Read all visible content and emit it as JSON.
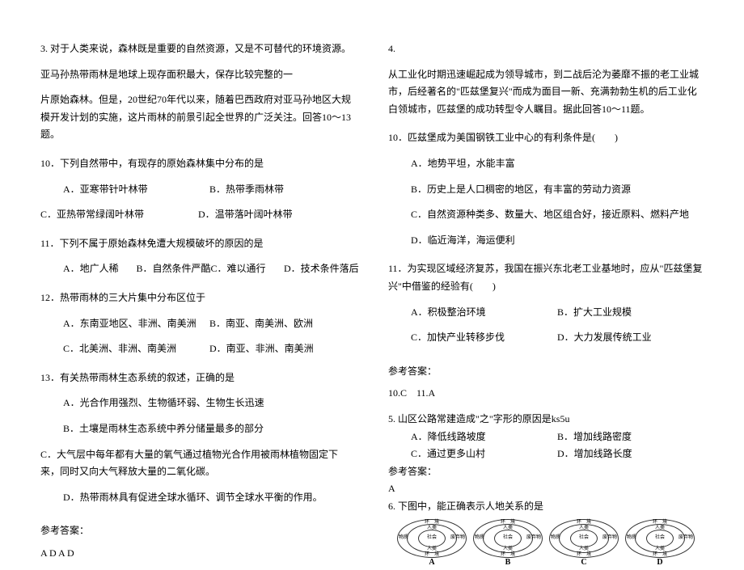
{
  "left": {
    "heading": "3. 对于人类来说，森林既是重要的自然资源，又是不可替代的环境资源。",
    "intro2": "亚马孙热带雨林是地球上现存面积最大，保存比较完整的一",
    "intro3": "片原始森林。但是，20世纪70年代以来，随着巴西政府对亚马孙地区大规模开发计划的实施，这片雨林的前景引起全世界的广泛关注。回答10～13题。",
    "q10": "10．下列自然带中，有现存的原始森林集中分布的是",
    "q10a": "A．亚寒带针叶林带",
    "q10b": "B．热带季雨林带",
    "q10c": "C．亚热带常绿阔叶林带",
    "q10d": "D．温带落叶阔叶林带",
    "q11": "11．下列不属于原始森林免遭大规模破坏的原因的是",
    "q11a": "A．地广人稀",
    "q11b": "B．自然条件严酷",
    "q11c": "C．难以通行",
    "q11d": "D．技术条件落后",
    "q12": "12．热带雨林的三大片集中分布区位于",
    "q12a": "A．东南亚地区、非洲、南美洲",
    "q12b": "B．南亚、南美洲、欧洲",
    "q12c": "C．北美洲、非洲、南美洲",
    "q12d": "D．南亚、非洲、南美洲",
    "q13": "13．有关热带雨林生态系统的叙述，正确的是",
    "q13a": "A．光合作用强烈、生物循环弱、生物生长迅速",
    "q13b": "B．土壤是雨林生态系统中养分储量最多的部分",
    "q13c": "C．大气层中每年都有大量的氧气通过植物光合作用被雨林植物固定下来，同时又向大气释放大量的二氧化碳。",
    "q13d": "D．热带雨林具有促进全球水循环、调节全球水平衡的作用。",
    "ansHeader": "参考答案：",
    "ansText": "A D A D"
  },
  "right": {
    "heading": "4.",
    "intro": "从工业化时期迅速崛起成为领导城市，到二战后沦为萎靡不振的老工业城市，后经著名的\"匹兹堡复兴\"而成为面目一新、充满勃勃生机的后工业化白领城市，匹兹堡的成功转型令人瞩目。据此回答10～11题。",
    "q10": "10．匹兹堡成为美国钢铁工业中心的有利条件是(　　)",
    "q10a": "A．地势平坦，水能丰富",
    "q10b": "B．历史上是人口稠密的地区，有丰富的劳动力资源",
    "q10c": "C．自然资源种类多、数量大、地区组合好，接近原料、燃料产地",
    "q10d": "D．临近海洋，海运便利",
    "q11": "11．为实现区域经济复苏，我国在振兴东北老工业基地时，应从\"匹兹堡复兴\"中借鉴的经验有(　　)",
    "q11a": "A．积极整治环境",
    "q11b": "B．扩大工业规模",
    "q11c": "C．加快产业转移步伐",
    "q11d": "D．大力发展传统工业",
    "ansHeader": "参考答案：",
    "ansText": "10.C　11.A",
    "q5": "5. 山区公路常建造成\"之\"字形的原因是ks5u",
    "q5a": "A．降低线路坡度",
    "q5b": "B．增加线路密度",
    "q5c": "C．通过更多山村",
    "q5d": "D．增加线路长度",
    "ans5Header": "参考答案：",
    "ans5Text": "A",
    "q6": "6. 下图中，能正确表示人地关系的是",
    "diagram": {
      "top": "环　境",
      "midTop": "人类",
      "center": "社会",
      "midBot": "环　境",
      "left": "物质",
      "right": "废弃物"
    },
    "letters": [
      "A",
      "B",
      "C",
      "D"
    ]
  }
}
